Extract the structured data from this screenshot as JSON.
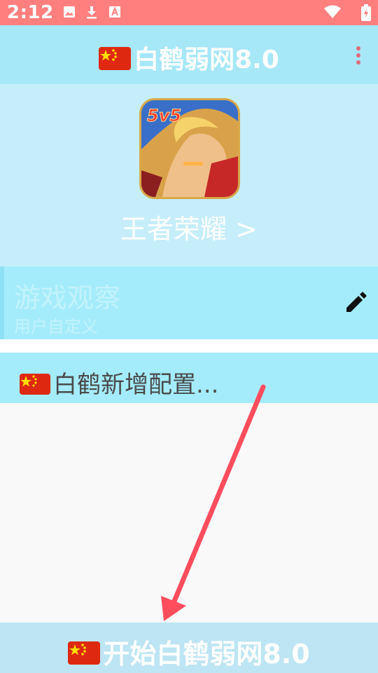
{
  "status_bar": {
    "time": "2:12",
    "icons": [
      "image-icon",
      "download-icon",
      "font-icon",
      "wifi-icon",
      "battery-icon"
    ]
  },
  "app_bar": {
    "title": "白鹤弱网8.0",
    "menu_icon": "more-vert-icon"
  },
  "header": {
    "game_name": "王者荣耀 >",
    "game_icon_text": "5v5"
  },
  "config": {
    "title": "游戏观察",
    "subtitle": "用户自定义",
    "edit_icon": "pencil-icon"
  },
  "add_config": {
    "label": "白鹤新增配置..."
  },
  "start_button": {
    "label": "开始白鹤弱网8.0"
  },
  "colors": {
    "status_bar": "#ff7f7f",
    "app_bar": "#a6e7f8",
    "header": "#c6eefa",
    "config_bg": "#a4ecfb",
    "start_button": "#bde5f3",
    "arrow": "#ff4d5e"
  }
}
